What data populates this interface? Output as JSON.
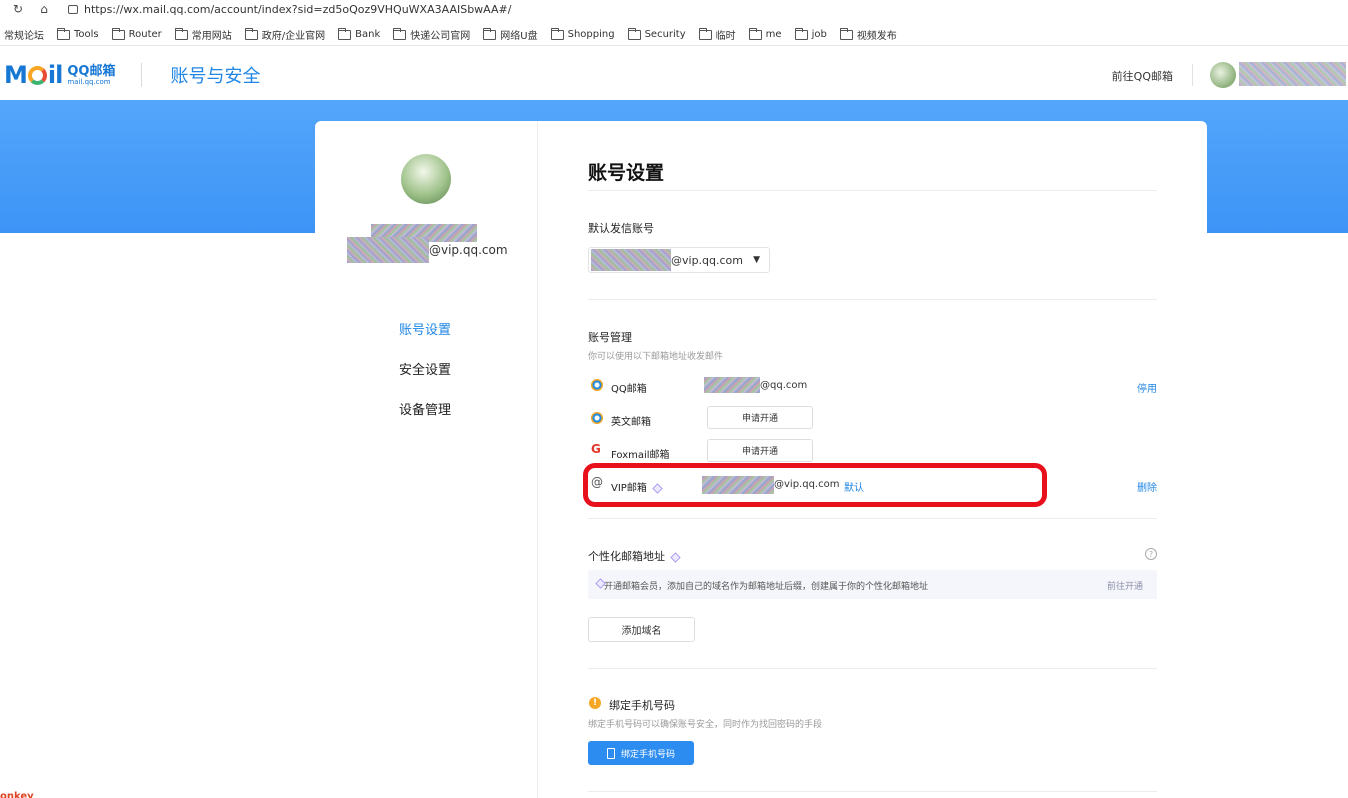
{
  "browser": {
    "url": "https://wx.mail.qq.com/account/index?sid=zd5oQoz9VHQuWXA3AAISbwAA#/",
    "bookmarks": [
      "常规论坛",
      "Tools",
      "Router",
      "常用网站",
      "政府/企业官网",
      "Bank",
      "快递公司官网",
      "网络U盘",
      "Shopping",
      "Security",
      "临时",
      "me",
      "job",
      "视频发布"
    ]
  },
  "header": {
    "logo_text": "MOil",
    "logo_qq": "QQ邮箱",
    "logo_domain": "mail.qq.com",
    "title": "账号与安全",
    "goto_link": "前往QQ邮箱"
  },
  "sidebar": {
    "email_suffix": "@vip.qq.com",
    "nav": [
      "账号设置",
      "安全设置",
      "设备管理"
    ]
  },
  "main": {
    "title": "账号设置",
    "default_sender": {
      "label": "默认发信账号",
      "value": "@vip.qq.com"
    },
    "accounts": {
      "label": "账号管理",
      "sub": "你可以使用以下邮箱地址收发邮件",
      "rows": [
        {
          "name": "QQ邮箱",
          "domain": "@qq.com",
          "action": "停用"
        },
        {
          "name": "英文邮箱",
          "button": "申请开通"
        },
        {
          "name": "Foxmail邮箱",
          "button": "申请开通"
        },
        {
          "name": "VIP邮箱",
          "domain": "@vip.qq.com",
          "tag": "默认",
          "action": "删除"
        }
      ]
    },
    "custom_domain": {
      "label": "个性化邮箱地址",
      "help": "?",
      "promo_text": "开通邮箱会员，添加自己的域名作为邮箱地址后缀，创建属于你的个性化邮箱地址",
      "promo_link": "前往开通",
      "add_button": "添加域名"
    },
    "phone": {
      "title": "绑定手机号码",
      "sub": "绑定手机号码可以确保账号安全，同时作为找回密码的手段",
      "button": "绑定手机号码"
    }
  },
  "footer_fragment": "onkey"
}
